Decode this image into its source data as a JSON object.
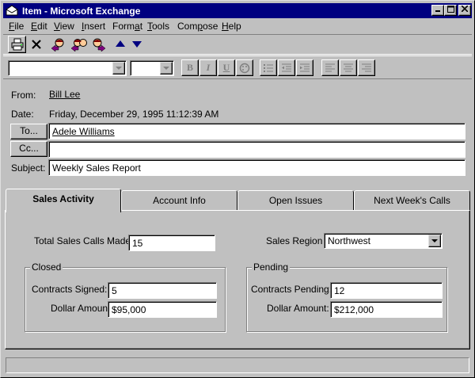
{
  "window": {
    "title": "Item - Microsoft Exchange",
    "minimize": "_",
    "maximize": "□",
    "close": "✕"
  },
  "menu": {
    "items": [
      {
        "key": "F",
        "rest": "ile"
      },
      {
        "key": "E",
        "rest": "dit"
      },
      {
        "key": "V",
        "rest": "iew"
      },
      {
        "key": "I",
        "rest": "nsert"
      },
      {
        "key": "",
        "pre": "Form",
        "key2": "a",
        "rest": "t"
      },
      {
        "key": "T",
        "rest": "ools"
      },
      {
        "key": "",
        "pre": "Com",
        "key2": "p",
        "rest": "ose"
      },
      {
        "key": "H",
        "rest": "elp"
      }
    ]
  },
  "toolbar": {
    "icons": [
      "printer-icon",
      "delete-icon",
      "reply-icon",
      "reply-all-icon",
      "forward-icon",
      "previous-item-icon",
      "next-item-icon"
    ]
  },
  "format_toolbar": {
    "font_name": "",
    "font_size": "",
    "bold": "B",
    "italic": "I",
    "underline": "U"
  },
  "header": {
    "from_label": "From:",
    "from_value": "Bill Lee",
    "date_label": "Date:",
    "date_value": "Friday, December 29, 1995 11:12:39 AM",
    "to_button": "To...",
    "to_value": "Adele Williams",
    "cc_button": "Cc...",
    "cc_value": "",
    "subject_label": "Subject:",
    "subject_value": "Weekly Sales Report"
  },
  "tabs": [
    {
      "label": "Sales Activity",
      "active": true
    },
    {
      "label": "Account Info",
      "active": false
    },
    {
      "label": "Open Issues",
      "active": false
    },
    {
      "label": "Next Week's Calls",
      "active": false
    }
  ],
  "sales_activity": {
    "total_calls_label": "Total Sales Calls Made:",
    "total_calls_value": "15",
    "region_label": "Sales Region",
    "region_value": "Northwest",
    "closed": {
      "title": "Closed",
      "contracts_label": "Contracts Signed:",
      "contracts_value": "5",
      "amount_label": "Dollar Amount:",
      "amount_value": "$95,000"
    },
    "pending": {
      "title": "Pending",
      "contracts_label": "Contracts Pending:",
      "contracts_value": "12",
      "amount_label": "Dollar Amount:",
      "amount_value": "$212,000"
    }
  },
  "status": {
    "text": ""
  }
}
